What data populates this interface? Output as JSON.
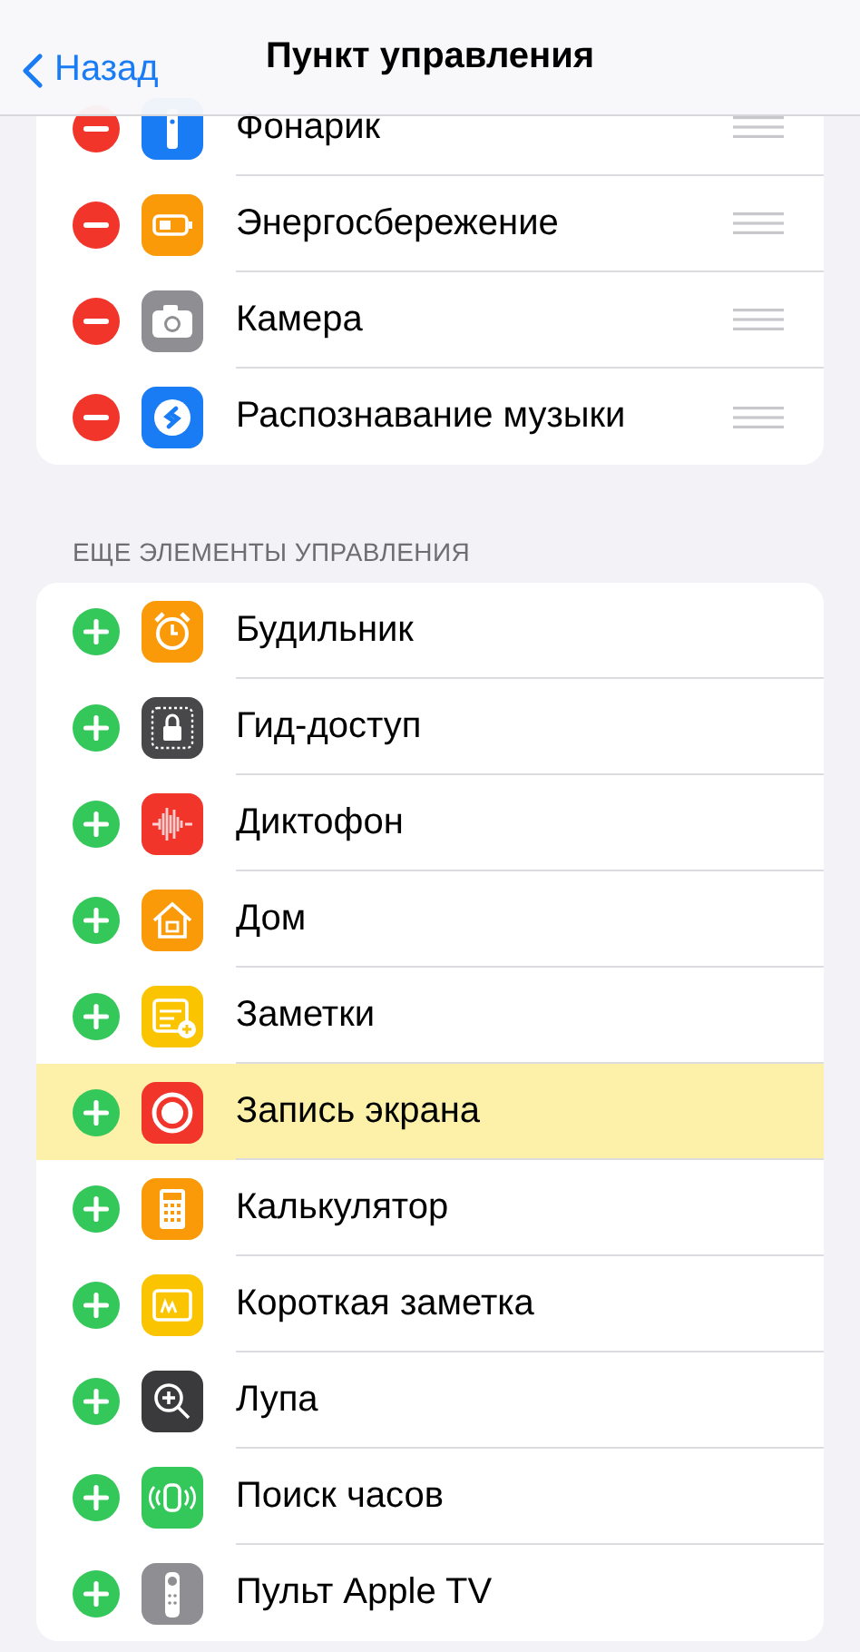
{
  "nav": {
    "back": "Назад",
    "title": "Пункт управления"
  },
  "included": {
    "kind": "remove",
    "items": [
      {
        "label": "Фонарик",
        "kind": "flashlight",
        "color": "#1a7cf5"
      },
      {
        "label": "Энергосбережение",
        "kind": "battery",
        "color": "#fb9a09"
      },
      {
        "label": "Камера",
        "kind": "camera",
        "color": "#8e8e93"
      },
      {
        "label": "Распознавание музыки",
        "kind": "shazam",
        "color": "#1a7cf5"
      }
    ]
  },
  "more": {
    "title": "ЕЩЕ ЭЛЕМЕНТЫ УПРАВЛЕНИЯ",
    "kind": "add",
    "items": [
      {
        "label": "Будильник",
        "kind": "alarm",
        "color": "#fb9a09",
        "highlighted": false
      },
      {
        "label": "Гид-доступ",
        "kind": "lock",
        "color": "#48484a",
        "highlighted": false
      },
      {
        "label": "Диктофон",
        "kind": "wave",
        "color": "#f2352b",
        "highlighted": false
      },
      {
        "label": "Дом",
        "kind": "home",
        "color": "#fb9a09",
        "highlighted": false
      },
      {
        "label": "Заметки",
        "kind": "notes",
        "color": "#fbc400",
        "highlighted": false
      },
      {
        "label": "Запись экрана",
        "kind": "record",
        "color": "#f2352b",
        "highlighted": true
      },
      {
        "label": "Калькулятор",
        "kind": "calculator",
        "color": "#fb9a09",
        "highlighted": false
      },
      {
        "label": "Короткая заметка",
        "kind": "quicknote",
        "color": "#fbc400",
        "highlighted": false
      },
      {
        "label": "Лупа",
        "kind": "magnifier",
        "color": "#3a3a3c",
        "highlighted": false
      },
      {
        "label": "Поиск часов",
        "kind": "watch",
        "color": "#34c759",
        "highlighted": false
      },
      {
        "label": "Пульт Apple TV",
        "kind": "remote",
        "color": "#8e8e93",
        "highlighted": false
      }
    ]
  }
}
